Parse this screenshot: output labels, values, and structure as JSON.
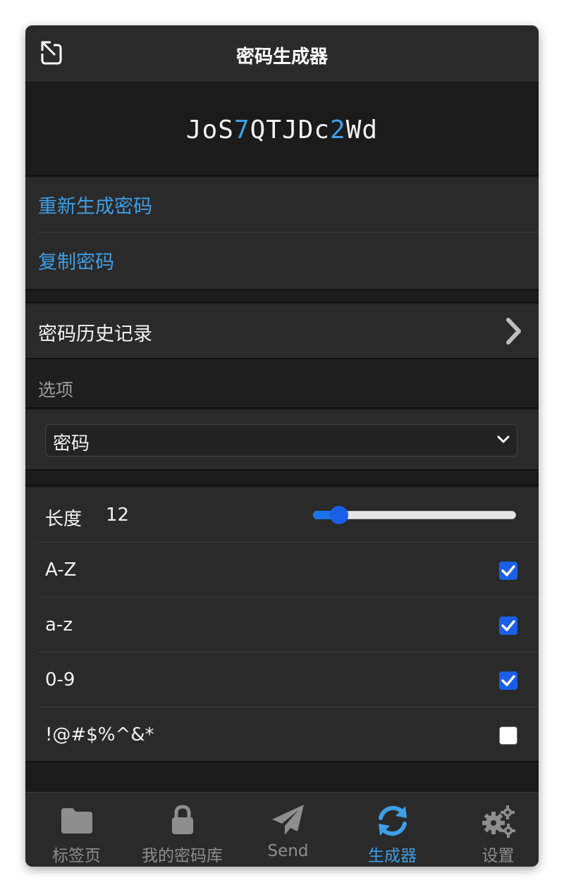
{
  "header": {
    "title": "密码生成器",
    "popout_icon": "popout-icon"
  },
  "password": {
    "prefix": "JoS",
    "d1": "7",
    "middle": "QTJDc",
    "d2": "2",
    "suffix": "Wd"
  },
  "actions": {
    "regenerate": "重新生成密码",
    "copy": "复制密码"
  },
  "history": {
    "label": "密码历史记录",
    "icon": "chevron-right-icon"
  },
  "options": {
    "heading": "选项",
    "type_select": {
      "value": "密码"
    },
    "length": {
      "label": "长度",
      "value": "12",
      "slider_fraction": 0.09
    },
    "uppercase": {
      "label": "A-Z",
      "checked": true
    },
    "lowercase": {
      "label": "a-z",
      "checked": true
    },
    "numbers": {
      "label": "0-9",
      "checked": true
    },
    "special": {
      "label": "!@#$%^&*",
      "checked": false
    }
  },
  "tabs": {
    "tab": "标签页",
    "vault": "我的密码库",
    "send": "Send",
    "generator": "生成器",
    "settings": "设置"
  },
  "colors": {
    "accent": "#3d9ee6",
    "checkbox": "#1a5fe6",
    "background": "#1e1e1e"
  }
}
